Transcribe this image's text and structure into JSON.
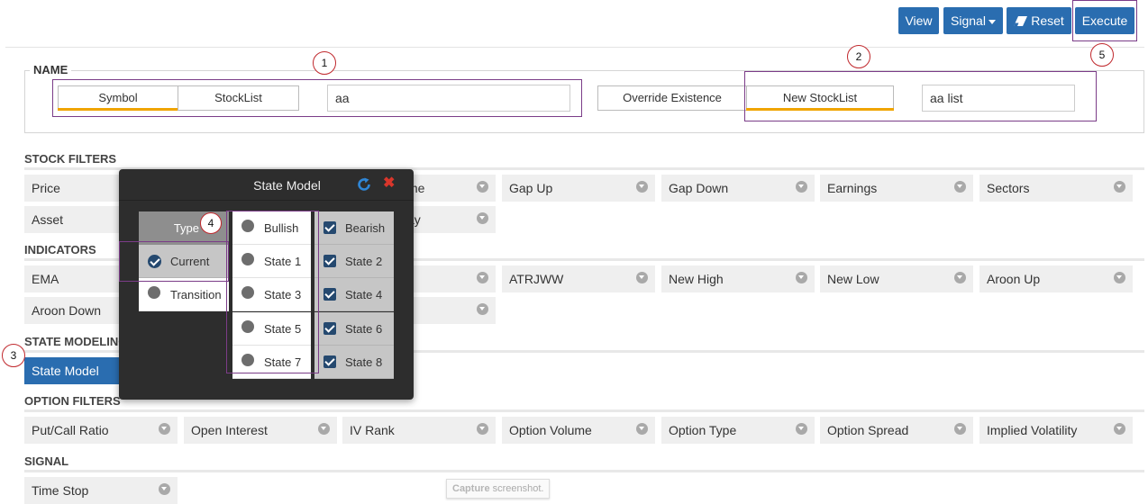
{
  "toolbar": {
    "view": "View",
    "signal": "Signal",
    "reset": "Reset",
    "execute": "Execute"
  },
  "callouts": [
    "1",
    "2",
    "3",
    "4",
    "5"
  ],
  "name_group": {
    "legend": "NAME",
    "symbol_tab": "Symbol",
    "stocklist_tab": "StockList",
    "name_value": "aa",
    "override_tab": "Override Existence",
    "new_stocklist_tab": "New StockList",
    "list_value": "aa list"
  },
  "sections": {
    "stock_filters": "STOCK FILTERS",
    "indicators": "INDICATORS",
    "state_modeling": "STATE MODELING",
    "option_filters": "OPTION FILTERS",
    "signal": "SIGNAL"
  },
  "stock_filters": {
    "row1": [
      "Price",
      "me",
      "Gap Up",
      "Gap Down",
      "Earnings",
      "Sectors"
    ],
    "row2": [
      "Asset",
      "ay"
    ]
  },
  "indicators": {
    "row1": [
      "EMA",
      "ATRJWW",
      "New High",
      "New Low",
      "Aroon Up"
    ],
    "row2": [
      "Aroon Down"
    ]
  },
  "state_modeling": [
    "State Model"
  ],
  "option_filters": [
    "Put/Call Ratio",
    "Open Interest",
    "IV Rank",
    "Option Volume",
    "Option Type",
    "Option Spread",
    "Implied Volatility"
  ],
  "signal": [
    "Time Stop"
  ],
  "dialog": {
    "title": "State Model",
    "type_header": "Type",
    "types": [
      "Current",
      "Transition"
    ],
    "bullish": [
      "Bullish",
      "State 1",
      "State 3",
      "State 5",
      "State 7"
    ],
    "bearish": [
      "Bearish",
      "State 2",
      "State 4",
      "State 6",
      "State 8"
    ]
  },
  "tooltip": {
    "strong": "Capture",
    "rest": " screenshot."
  }
}
